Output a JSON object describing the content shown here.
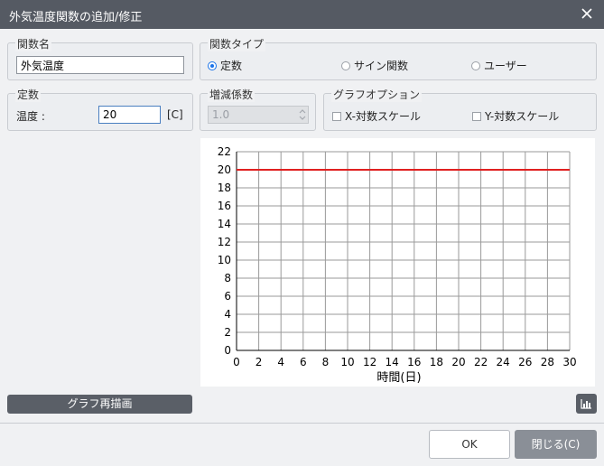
{
  "window": {
    "title": "外気温度関数の追加/修正"
  },
  "name_group": {
    "legend": "関数名",
    "value": "外気温度"
  },
  "type_group": {
    "legend": "関数タイプ",
    "options": [
      {
        "label": "定数",
        "selected": true
      },
      {
        "label": "サイン関数",
        "selected": false
      },
      {
        "label": "ユーザー",
        "selected": false
      }
    ]
  },
  "constant_group": {
    "legend": "定数",
    "temp_label": "温度 :",
    "temp_value": "20",
    "unit": "[C]"
  },
  "coef_group": {
    "legend": "増減係数",
    "value": "1.0"
  },
  "graph_group": {
    "legend": "グラフオプション",
    "x_log": "X-対数スケール",
    "y_log": "Y-対数スケール"
  },
  "chart_data": {
    "type": "line",
    "xlabel": "時間(日)",
    "ylabel": "",
    "xlim": [
      0,
      30
    ],
    "ylim": [
      0,
      22
    ],
    "x_ticks": [
      "0",
      "2",
      "4",
      "6",
      "8",
      "10",
      "12",
      "14",
      "16",
      "18",
      "20",
      "22",
      "24",
      "26",
      "28",
      "30"
    ],
    "y_ticks": [
      "0",
      "2",
      "4",
      "6",
      "8",
      "10",
      "12",
      "14",
      "16",
      "18",
      "20",
      "22"
    ],
    "grid": true,
    "series": [
      {
        "x": [
          0,
          30
        ],
        "values": [
          20,
          20
        ],
        "color": "#e02020"
      }
    ]
  },
  "buttons": {
    "redraw": "グラフ再描画",
    "ok": "OK",
    "close": "閉じる(C)"
  },
  "icons": {
    "close": "close-icon",
    "chart": "bar-chart-icon",
    "spinner": "spinner-arrows-icon"
  }
}
